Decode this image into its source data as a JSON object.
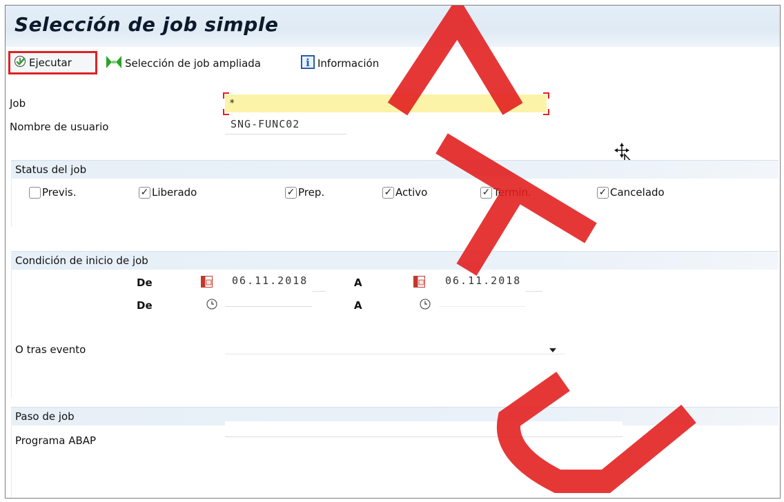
{
  "window": {
    "title": "Selección de job simple"
  },
  "toolbar": {
    "execute_label": "Ejecutar",
    "extended_label": "Selección de job ampliada",
    "info_label": "Información"
  },
  "form": {
    "job_label": "Job",
    "job_value": "*",
    "user_label": "Nombre de usuario",
    "user_value": "SNG-FUNC02"
  },
  "status": {
    "title": "Status del job",
    "items": [
      {
        "label": "Previs.",
        "checked": false
      },
      {
        "label": "Liberado",
        "checked": true
      },
      {
        "label": "Prep.",
        "checked": true
      },
      {
        "label": "Activo",
        "checked": true
      },
      {
        "label": "Termin.",
        "checked": true
      },
      {
        "label": "Cancelado",
        "checked": true
      }
    ]
  },
  "start_condition": {
    "title": "Condición de inicio de job",
    "from_label": "De",
    "to_label": "A",
    "date_from": "06.11.2018",
    "date_to": "06.11.2018",
    "time_from": "",
    "time_to": "",
    "event_label": "O tras evento",
    "event_value": ""
  },
  "job_step": {
    "title": "Paso de job",
    "program_label": "Programa ABAP",
    "program_value": ""
  },
  "watermark": {
    "text": [
      "A",
      "T",
      "U"
    ]
  },
  "colors": {
    "title_bg": "#e4eef8",
    "input_required": "#fbf3a8",
    "highlight_border": "#e02020"
  }
}
